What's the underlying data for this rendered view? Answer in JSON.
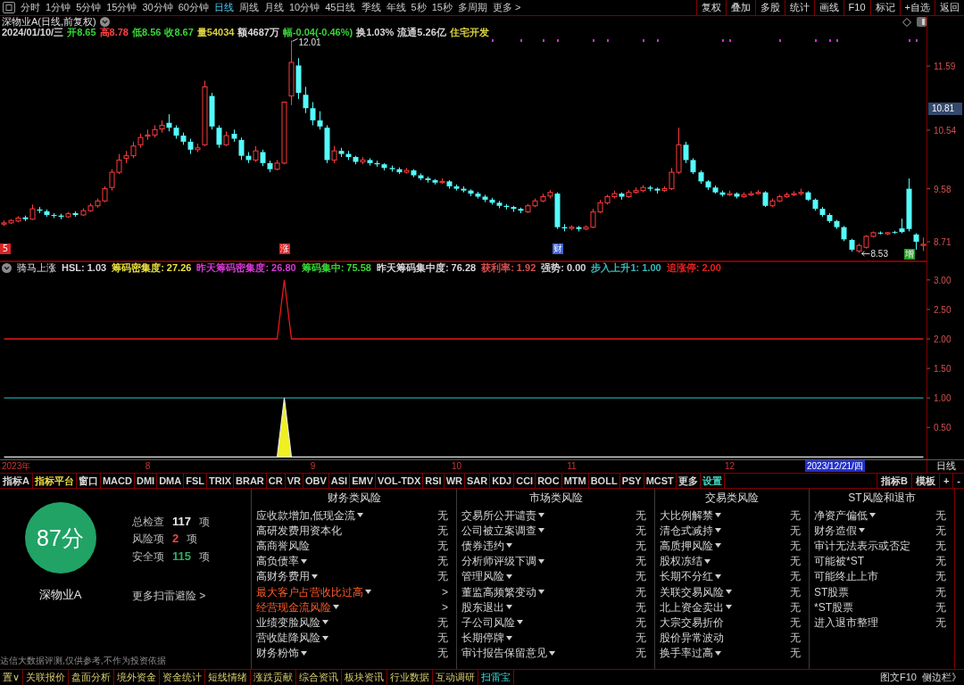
{
  "toolbar": {
    "periods": [
      {
        "label": "分时",
        "selected": false
      },
      {
        "label": "1分钟",
        "selected": false
      },
      {
        "label": "5分钟",
        "selected": false
      },
      {
        "label": "15分钟",
        "selected": false
      },
      {
        "label": "30分钟",
        "selected": false
      },
      {
        "label": "60分钟",
        "selected": false
      },
      {
        "label": "日线",
        "selected": true
      },
      {
        "label": "周线",
        "selected": false
      },
      {
        "label": "月线",
        "selected": false
      },
      {
        "label": "10分钟",
        "selected": false
      },
      {
        "label": "45日线",
        "selected": false
      },
      {
        "label": "季线",
        "selected": false
      },
      {
        "label": "年线",
        "selected": false
      },
      {
        "label": "5秒",
        "selected": false
      },
      {
        "label": "15秒",
        "selected": false
      },
      {
        "label": "多周期",
        "selected": false
      },
      {
        "label": "更多 >",
        "selected": false
      }
    ],
    "buttons": [
      "复权",
      "叠加",
      "多股",
      "统计",
      "画线",
      "F10",
      "标记",
      "+自选",
      "返回"
    ]
  },
  "price_pane": {
    "title": "深物业A(日线,前复权)",
    "quote": [
      {
        "text": "2024/01/10/三",
        "color": "#d8d8d8"
      },
      {
        "text": "开8.65",
        "color": "#39d339"
      },
      {
        "text": "高8.78",
        "color": "#ff4040"
      },
      {
        "text": "低8.56",
        "color": "#39d339"
      },
      {
        "text": "收8.67",
        "color": "#39d339"
      },
      {
        "text": "量54034",
        "color": "#d8d040"
      },
      {
        "text": "额4687万",
        "color": "#d8d8d8"
      },
      {
        "text": "幅-0.04(-0.46%)",
        "color": "#39d339"
      },
      {
        "text": "换1.03%",
        "color": "#d8d8d8"
      },
      {
        "text": "流通5.26亿",
        "color": "#d8d8d8"
      },
      {
        "text": "住宅开发",
        "color": "#d8d040"
      }
    ],
    "signal_markers": [
      {
        "label": "5",
        "color": "#d82424"
      },
      {
        "label": "涨",
        "color": "#d82424"
      },
      {
        "label": "财",
        "color": "#3a62d8"
      },
      {
        "label": "增",
        "color": "#26a026"
      }
    ],
    "cursor_price": "10.81",
    "chart_data": [
      {
        "type": "candlestick",
        "ylim": [
          8.39,
          12.41
        ],
        "yticks": [
          8.71,
          9.58,
          10.54,
          11.59
        ],
        "tick_labels": "y",
        "categories": [
          null,
          null,
          null,
          null,
          null,
          null,
          null,
          null,
          null,
          null,
          null,
          null,
          null,
          null,
          null,
          null,
          null,
          null,
          null,
          null,
          null,
          null,
          null,
          null,
          null,
          null,
          null,
          null,
          null,
          null,
          null,
          null,
          null,
          null,
          null,
          null,
          null,
          null,
          null,
          null,
          null,
          null,
          null,
          null,
          null,
          null,
          null,
          null,
          null,
          null,
          null,
          null,
          null,
          null,
          null,
          null,
          null,
          null,
          null,
          null,
          null,
          null,
          null,
          null,
          null,
          null,
          null,
          null,
          null,
          null,
          null,
          null,
          null,
          null,
          null,
          null,
          null,
          null,
          null,
          null,
          null,
          null,
          null,
          null,
          null,
          null,
          null,
          null,
          null,
          null,
          null,
          null,
          null,
          null,
          null,
          null,
          null,
          null,
          null,
          null,
          null,
          null,
          null,
          null,
          null,
          null,
          null,
          null,
          null,
          null,
          null,
          null,
          null,
          null,
          null,
          null,
          null,
          null,
          null,
          null,
          null,
          null,
          null,
          null,
          null,
          null,
          null,
          null,
          null
        ],
        "ohlc": [
          [
            9.0,
            9.06,
            8.97,
            9.02
          ],
          [
            9.02,
            9.08,
            9.0,
            9.06
          ],
          [
            9.05,
            9.13,
            9.03,
            9.1
          ],
          [
            9.11,
            9.14,
            9.05,
            9.08
          ],
          [
            9.08,
            9.32,
            9.07,
            9.25
          ],
          [
            9.24,
            9.28,
            9.18,
            9.22
          ],
          [
            9.21,
            9.24,
            9.12,
            9.15
          ],
          [
            9.15,
            9.18,
            9.1,
            9.14
          ],
          [
            9.14,
            9.17,
            9.08,
            9.12
          ],
          [
            9.12,
            9.2,
            9.1,
            9.17
          ],
          [
            9.18,
            9.21,
            9.12,
            9.15
          ],
          [
            9.15,
            9.26,
            9.14,
            9.22
          ],
          [
            9.22,
            9.34,
            9.2,
            9.3
          ],
          [
            9.3,
            9.42,
            9.27,
            9.38
          ],
          [
            9.38,
            9.62,
            9.36,
            9.58
          ],
          [
            9.6,
            9.9,
            9.55,
            9.85
          ],
          [
            9.85,
            10.15,
            9.82,
            10.05
          ],
          [
            10.08,
            10.2,
            10.0,
            10.12
          ],
          [
            10.12,
            10.35,
            10.08,
            10.28
          ],
          [
            10.3,
            10.48,
            10.25,
            10.42
          ],
          [
            10.44,
            10.55,
            10.38,
            10.46
          ],
          [
            10.46,
            10.62,
            10.42,
            10.55
          ],
          [
            10.56,
            10.7,
            10.5,
            10.62
          ],
          [
            10.66,
            10.8,
            10.52,
            10.58
          ],
          [
            10.58,
            10.62,
            10.4,
            10.45
          ],
          [
            10.45,
            10.5,
            10.3,
            10.35
          ],
          [
            10.35,
            10.4,
            10.15,
            10.22
          ],
          [
            10.22,
            10.32,
            10.18,
            10.25
          ],
          [
            10.3,
            11.35,
            10.28,
            11.25
          ],
          [
            11.1,
            11.15,
            10.55,
            10.6
          ],
          [
            10.58,
            10.62,
            10.25,
            10.3
          ],
          [
            10.3,
            10.52,
            10.28,
            10.45
          ],
          [
            10.48,
            10.55,
            10.35,
            10.4
          ],
          [
            10.38,
            10.42,
            10.05,
            10.12
          ],
          [
            10.12,
            10.18,
            10.0,
            10.05
          ],
          [
            10.05,
            10.28,
            10.02,
            10.2
          ],
          [
            10.18,
            10.22,
            9.95,
            10.0
          ],
          [
            10.0,
            10.04,
            9.85,
            9.9
          ],
          [
            9.9,
            10.05,
            9.88,
            10.0
          ],
          [
            10.0,
            11.0,
            9.98,
            11.0
          ],
          [
            11.1,
            12.01,
            10.95,
            11.65
          ],
          [
            11.6,
            11.72,
            11.05,
            11.15
          ],
          [
            11.12,
            11.25,
            10.82,
            10.9
          ],
          [
            10.9,
            11.0,
            10.62,
            10.7
          ],
          [
            10.7,
            10.85,
            10.55,
            10.6
          ],
          [
            10.58,
            10.62,
            10.0,
            10.05
          ],
          [
            10.05,
            10.28,
            10.0,
            10.2
          ],
          [
            10.2,
            10.25,
            10.1,
            10.15
          ],
          [
            10.15,
            10.2,
            10.05,
            10.1
          ],
          [
            10.1,
            10.12,
            9.98,
            10.02
          ],
          [
            10.02,
            10.1,
            9.98,
            10.05
          ],
          [
            10.05,
            10.08,
            9.96,
            10.0
          ],
          [
            10.0,
            10.04,
            9.94,
            9.98
          ],
          [
            9.98,
            10.0,
            9.88,
            9.92
          ],
          [
            9.92,
            9.96,
            9.86,
            9.9
          ],
          [
            9.9,
            9.93,
            9.82,
            9.85
          ],
          [
            9.85,
            9.92,
            9.83,
            9.88
          ],
          [
            9.88,
            9.9,
            9.77,
            9.8
          ],
          [
            9.8,
            9.83,
            9.72,
            9.75
          ],
          [
            9.75,
            9.78,
            9.68,
            9.72
          ],
          [
            9.72,
            9.74,
            9.65,
            9.68
          ],
          [
            9.68,
            9.75,
            9.66,
            9.7
          ],
          [
            9.7,
            9.72,
            9.58,
            9.62
          ],
          [
            9.62,
            9.65,
            9.55,
            9.58
          ],
          [
            9.58,
            9.62,
            9.52,
            9.55
          ],
          [
            9.55,
            9.57,
            9.46,
            9.5
          ],
          [
            9.5,
            9.53,
            9.42,
            9.45
          ],
          [
            9.45,
            9.48,
            9.36,
            9.4
          ],
          [
            9.4,
            9.43,
            9.32,
            9.35
          ],
          [
            9.35,
            9.38,
            9.26,
            9.3
          ],
          [
            9.3,
            9.33,
            9.24,
            9.28
          ],
          [
            9.28,
            9.3,
            9.2,
            9.25
          ],
          [
            9.25,
            9.27,
            9.18,
            9.22
          ],
          [
            9.2,
            9.33,
            9.18,
            9.3
          ],
          [
            9.3,
            9.42,
            9.28,
            9.38
          ],
          [
            9.38,
            9.5,
            9.36,
            9.45
          ],
          [
            9.46,
            9.56,
            9.42,
            9.52
          ],
          [
            9.5,
            9.52,
            8.92,
            8.95
          ],
          [
            8.95,
            9.0,
            8.88,
            8.93
          ],
          [
            8.93,
            8.98,
            8.9,
            8.95
          ],
          [
            8.95,
            8.97,
            8.88,
            8.92
          ],
          [
            8.92,
            8.98,
            8.9,
            8.95
          ],
          [
            8.95,
            9.25,
            8.93,
            9.2
          ],
          [
            9.2,
            9.4,
            9.18,
            9.35
          ],
          [
            9.35,
            9.48,
            9.32,
            9.45
          ],
          [
            9.45,
            9.55,
            9.42,
            9.5
          ],
          [
            9.5,
            9.52,
            9.4,
            9.45
          ],
          [
            9.45,
            9.56,
            9.43,
            9.52
          ],
          [
            9.52,
            9.6,
            9.5,
            9.55
          ],
          [
            9.55,
            9.64,
            9.52,
            9.6
          ],
          [
            9.6,
            9.63,
            9.54,
            9.58
          ],
          [
            9.58,
            9.6,
            9.5,
            9.55
          ],
          [
            9.55,
            9.62,
            9.53,
            9.58
          ],
          [
            9.58,
            9.92,
            9.56,
            9.85
          ],
          [
            9.85,
            10.58,
            9.82,
            10.3
          ],
          [
            10.3,
            10.35,
            10.0,
            10.05
          ],
          [
            10.05,
            10.08,
            9.82,
            9.85
          ],
          [
            9.85,
            9.88,
            9.66,
            9.7
          ],
          [
            9.7,
            9.72,
            9.56,
            9.6
          ],
          [
            9.6,
            9.63,
            9.5,
            9.52
          ],
          [
            9.52,
            9.55,
            9.45,
            9.48
          ],
          [
            9.48,
            9.55,
            9.46,
            9.5
          ],
          [
            9.5,
            9.52,
            9.42,
            9.45
          ],
          [
            9.45,
            9.52,
            9.43,
            9.48
          ],
          [
            9.48,
            9.54,
            9.46,
            9.5
          ],
          [
            9.5,
            9.56,
            9.48,
            9.52
          ],
          [
            9.52,
            9.54,
            9.28,
            9.3
          ],
          [
            9.3,
            9.42,
            9.28,
            9.38
          ],
          [
            9.38,
            9.48,
            9.36,
            9.45
          ],
          [
            9.45,
            9.52,
            9.43,
            9.48
          ],
          [
            9.48,
            9.54,
            9.46,
            9.5
          ],
          [
            9.5,
            9.58,
            9.47,
            9.52
          ],
          [
            9.52,
            9.54,
            9.38,
            9.4
          ],
          [
            9.4,
            9.42,
            9.22,
            9.25
          ],
          [
            9.25,
            9.28,
            9.12,
            9.15
          ],
          [
            9.15,
            9.18,
            9.02,
            9.05
          ],
          [
            9.05,
            9.07,
            8.92,
            8.95
          ],
          [
            8.95,
            8.97,
            8.72,
            8.75
          ],
          [
            8.74,
            8.76,
            8.55,
            8.58
          ],
          [
            8.56,
            8.68,
            8.53,
            8.65
          ],
          [
            8.62,
            8.82,
            8.6,
            8.8
          ],
          [
            8.8,
            8.88,
            8.78,
            8.86
          ],
          [
            8.86,
            8.88,
            8.83,
            8.85
          ],
          [
            8.84,
            8.87,
            8.82,
            8.86
          ],
          [
            8.87,
            8.89,
            8.84,
            8.86
          ],
          [
            8.93,
            9.09,
            8.85,
            8.87
          ],
          [
            9.58,
            9.75,
            8.88,
            8.92
          ],
          [
            8.83,
            8.85,
            8.58,
            8.71
          ],
          [
            8.65,
            8.78,
            8.56,
            8.67
          ]
        ],
        "annotations": [
          "12.01",
          "8.53"
        ]
      }
    ]
  },
  "indicator_pane": {
    "indicator_name": "骑马上涨",
    "readouts": [
      {
        "text": "HSL: 1.03",
        "color": "#d8d8d8"
      },
      {
        "text": "筹码密集度: 27.26",
        "color": "#e8e040"
      },
      {
        "text": "昨天筹码密集度: 26.80",
        "color": "#d838d8"
      },
      {
        "text": "筹码集中: 75.58",
        "color": "#38d838"
      },
      {
        "text": "昨天筹码集中度: 76.28",
        "color": "#d8d8d8"
      },
      {
        "text": "获利率: 1.92",
        "color": "#d85050"
      },
      {
        "text": "强势: 0.00",
        "color": "#d8d8d8"
      },
      {
        "text": "步入上升1: 1.00",
        "color": "#38b8b8"
      },
      {
        "text": "追涨停: 2.00",
        "color": "#e82020"
      }
    ],
    "chart_data": [
      {
        "type": "line",
        "ylim": [
          -0.04,
          3.315
        ],
        "yticks": [
          {
            "value": 0.5,
            "label": "0.50"
          },
          {
            "value": 1,
            "label": "1.00"
          },
          {
            "value": 1.5,
            "label": "1.50"
          },
          {
            "value": 2,
            "label": "2.00"
          },
          {
            "value": 2.5,
            "label": "2.50"
          },
          {
            "value": 3,
            "label": "3.00"
          }
        ],
        "categories": [
          null,
          null,
          null,
          null,
          null,
          null,
          null,
          null,
          null,
          null,
          null,
          null,
          null,
          null,
          null,
          null,
          null,
          null,
          null,
          null,
          "8",
          null,
          null,
          null,
          null,
          null,
          null,
          null,
          null,
          null,
          null,
          null,
          null,
          null,
          null,
          null,
          null,
          null,
          null,
          null,
          null,
          null,
          null,
          "9",
          null,
          null,
          null,
          null,
          null,
          null,
          null,
          null,
          null,
          null,
          null,
          null,
          null,
          null,
          null,
          null,
          null,
          null,
          null,
          "10",
          null,
          null,
          null,
          null,
          null,
          null,
          null,
          null,
          null,
          null,
          null,
          null,
          null,
          null,
          null,
          "11",
          null,
          null,
          null,
          null,
          null,
          null,
          null,
          null,
          null,
          null,
          null,
          null,
          null,
          null,
          null,
          null,
          null,
          null,
          null,
          null,
          null,
          "12",
          null,
          null,
          null,
          null,
          null,
          null,
          null,
          null,
          null,
          null,
          null,
          null,
          null,
          null,
          null,
          null,
          null,
          null,
          null,
          null,
          null,
          null,
          null,
          null,
          null,
          null,
          null
        ],
        "series": [
          {
            "type": "line",
            "color": "#e81818",
            "values": [
              2,
              2,
              2,
              2,
              2,
              2,
              2,
              2,
              2,
              2,
              2,
              2,
              2,
              2,
              2,
              2,
              2,
              2,
              2,
              2,
              2,
              2,
              2,
              2,
              2,
              2,
              2,
              2,
              2,
              2,
              2,
              2,
              2,
              2,
              2,
              2,
              2,
              2,
              2,
              3,
              2,
              2,
              2,
              2,
              2,
              2,
              2,
              2,
              2,
              2,
              2,
              2,
              2,
              2,
              2,
              2,
              2,
              2,
              2,
              2,
              2,
              2,
              2,
              2,
              2,
              2,
              2,
              2,
              2,
              2,
              2,
              2,
              2,
              2,
              2,
              2,
              2,
              2,
              2,
              2,
              2,
              2,
              2,
              2,
              2,
              2,
              2,
              2,
              2,
              2,
              2,
              2,
              2,
              2,
              2,
              2,
              2,
              2,
              2,
              2,
              2,
              2,
              2,
              2,
              2,
              2,
              2,
              2,
              2,
              2,
              2,
              2,
              2,
              2,
              2,
              2,
              2,
              2,
              2,
              2,
              2,
              2,
              2,
              2,
              2,
              2,
              2,
              2,
              2
            ]
          },
          {
            "type": "line",
            "color": "#1fa5a5",
            "values": [
              1,
              1,
              1,
              1,
              1,
              1,
              1,
              1,
              1,
              1,
              1,
              1,
              1,
              1,
              1,
              1,
              1,
              1,
              1,
              1,
              1,
              1,
              1,
              1,
              1,
              1,
              1,
              1,
              1,
              1,
              1,
              1,
              1,
              1,
              1,
              1,
              1,
              1,
              1,
              1,
              1,
              1,
              1,
              1,
              1,
              1,
              1,
              1,
              1,
              1,
              1,
              1,
              1,
              1,
              1,
              1,
              1,
              1,
              1,
              1,
              1,
              1,
              1,
              1,
              1,
              1,
              1,
              1,
              1,
              1,
              1,
              1,
              1,
              1,
              1,
              1,
              1,
              1,
              1,
              1,
              1,
              1,
              1,
              1,
              1,
              1,
              1,
              1,
              1,
              1,
              1,
              1,
              1,
              1,
              1,
              1,
              1,
              1,
              1,
              1,
              1,
              1,
              1,
              1,
              1,
              1,
              1,
              1,
              1,
              1,
              1,
              1,
              1,
              1,
              1,
              1,
              1,
              1,
              1,
              1,
              1,
              1,
              1,
              1,
              1,
              1,
              1,
              1,
              1
            ]
          },
          {
            "type": "area",
            "color": "#f0f020",
            "values": [
              0,
              0,
              0,
              0,
              0,
              0,
              0,
              0,
              0,
              0,
              0,
              0,
              0,
              0,
              0,
              0,
              0,
              0,
              0,
              0,
              0,
              0,
              0,
              0,
              0,
              0,
              0,
              0,
              0,
              0,
              0,
              0,
              0,
              0,
              0,
              0,
              0,
              0,
              0,
              1,
              0,
              0,
              0,
              0,
              0,
              0,
              0,
              0,
              0,
              0,
              0,
              0,
              0,
              0,
              0,
              0,
              0,
              0,
              0,
              0,
              0,
              0,
              0,
              0,
              0,
              0,
              0,
              0,
              0,
              0,
              0,
              0,
              0,
              0,
              0,
              0,
              0,
              0,
              0,
              0,
              0,
              0,
              0,
              0,
              0,
              0,
              0,
              0,
              0,
              0,
              0,
              0,
              0,
              0,
              0,
              0,
              0,
              0,
              0,
              0,
              0,
              0,
              0,
              0,
              0,
              0,
              0,
              0,
              0,
              0,
              0,
              0,
              0,
              0,
              0,
              0,
              0,
              0,
              0,
              0,
              0,
              0,
              0,
              0,
              0,
              0,
              0,
              0,
              0
            ]
          }
        ]
      }
    ],
    "year_label": "2023年",
    "cursor_date": "2023/12/21/四",
    "period_label": "日线"
  },
  "indicator_tabs": {
    "left_label": "指标A",
    "items": [
      {
        "label": "指标平台",
        "color": "#e8d840"
      },
      {
        "label": "窗口",
        "color": "#d8d8d8"
      },
      {
        "label": "MACD",
        "color": "#d8d8d8"
      },
      {
        "label": "DMI",
        "color": "#d8d8d8"
      },
      {
        "label": "DMA",
        "color": "#d8d8d8"
      },
      {
        "label": "FSL",
        "color": "#d8d8d8"
      },
      {
        "label": "TRIX",
        "color": "#d8d8d8"
      },
      {
        "label": "BRAR",
        "color": "#d8d8d8"
      },
      {
        "label": "CR",
        "color": "#d8d8d8"
      },
      {
        "label": "VR",
        "color": "#d8d8d8"
      },
      {
        "label": "OBV",
        "color": "#d8d8d8"
      },
      {
        "label": "ASI",
        "color": "#d8d8d8"
      },
      {
        "label": "EMV",
        "color": "#d8d8d8"
      },
      {
        "label": "VOL-TDX",
        "color": "#d8d8d8"
      },
      {
        "label": "RSI",
        "color": "#d8d8d8"
      },
      {
        "label": "WR",
        "color": "#d8d8d8"
      },
      {
        "label": "SAR",
        "color": "#d8d8d8"
      },
      {
        "label": "KDJ",
        "color": "#d8d8d8"
      },
      {
        "label": "CCI",
        "color": "#d8d8d8"
      },
      {
        "label": "ROC",
        "color": "#d8d8d8"
      },
      {
        "label": "MTM",
        "color": "#d8d8d8"
      },
      {
        "label": "BOLL",
        "color": "#d8d8d8"
      },
      {
        "label": "PSY",
        "color": "#d8d8d8"
      },
      {
        "label": "MCST",
        "color": "#d8d8d8"
      },
      {
        "label": "更多",
        "color": "#d8d8d8"
      },
      {
        "label": "设置",
        "color": "#40d8c0"
      }
    ],
    "right_items": [
      "指标B",
      "模板",
      "+",
      "-"
    ]
  },
  "scan_panel": {
    "score": "87分",
    "stock": "深物业A",
    "stats": [
      {
        "label": "总检查",
        "value": "117",
        "unit": "项",
        "color": "#e8e8e8"
      },
      {
        "label": "风险项",
        "value": "2",
        "unit": "项",
        "color": "#e84848"
      },
      {
        "label": "安全项",
        "value": "115",
        "unit": "项",
        "color": "#2eb060"
      }
    ],
    "more_link": "更多扫雷避险 >",
    "disclaimer": "达信大数据评测,仅供参考,不作为投资依据",
    "columns": [
      {
        "title": "财务类风险",
        "items": [
          {
            "text": "应收款增加,低现金流",
            "expandable": true,
            "risk": false,
            "status": "无"
          },
          {
            "text": "高研发费用资本化",
            "expandable": false,
            "risk": false,
            "status": "无"
          },
          {
            "text": "高商誉风险",
            "expandable": false,
            "risk": false,
            "status": "无"
          },
          {
            "text": "高负债率",
            "expandable": true,
            "risk": false,
            "status": "无"
          },
          {
            "text": "高财务费用",
            "expandable": true,
            "risk": false,
            "status": "无"
          },
          {
            "text": "最大客户占营收比过高",
            "expandable": true,
            "risk": true,
            "status": ">"
          },
          {
            "text": "经营现金流风险",
            "expandable": true,
            "risk": true,
            "status": ">"
          },
          {
            "text": "业绩变脸风险",
            "expandable": true,
            "risk": false,
            "status": "无"
          },
          {
            "text": "营收陡降风险",
            "expandable": true,
            "risk": false,
            "status": "无"
          },
          {
            "text": "财务粉饰",
            "expandable": true,
            "risk": false,
            "status": "无"
          }
        ]
      },
      {
        "title": "市场类风险",
        "items": [
          {
            "text": "交易所公开谴责",
            "expandable": true,
            "risk": false,
            "status": "无"
          },
          {
            "text": "公司被立案调查",
            "expandable": true,
            "risk": false,
            "status": "无"
          },
          {
            "text": "债券违约",
            "expandable": true,
            "risk": false,
            "status": "无"
          },
          {
            "text": "分析师评级下调",
            "expandable": true,
            "risk": false,
            "status": "无"
          },
          {
            "text": "管理风险",
            "expandable": true,
            "risk": false,
            "status": "无"
          },
          {
            "text": "董监高频繁变动",
            "expandable": true,
            "risk": false,
            "status": "无"
          },
          {
            "text": "股东退出",
            "expandable": true,
            "risk": false,
            "status": "无"
          },
          {
            "text": "子公司风险",
            "expandable": true,
            "risk": false,
            "status": "无"
          },
          {
            "text": "长期停牌",
            "expandable": true,
            "risk": false,
            "status": "无"
          },
          {
            "text": "审计报告保留意见",
            "expandable": true,
            "risk": false,
            "status": "无"
          }
        ]
      },
      {
        "title": "交易类风险",
        "items": [
          {
            "text": "大比例解禁",
            "expandable": true,
            "risk": false,
            "status": "无"
          },
          {
            "text": "清仓式减持",
            "expandable": true,
            "risk": false,
            "status": "无"
          },
          {
            "text": "高质押风险",
            "expandable": true,
            "risk": false,
            "status": "无"
          },
          {
            "text": "股权冻结",
            "expandable": true,
            "risk": false,
            "status": "无"
          },
          {
            "text": "长期不分红",
            "expandable": true,
            "risk": false,
            "status": "无"
          },
          {
            "text": "关联交易风险",
            "expandable": true,
            "risk": false,
            "status": "无"
          },
          {
            "text": "北上资金卖出",
            "expandable": true,
            "risk": false,
            "status": "无"
          },
          {
            "text": "大宗交易折价",
            "expandable": false,
            "risk": false,
            "status": "无"
          },
          {
            "text": "股价异常波动",
            "expandable": false,
            "risk": false,
            "status": "无"
          },
          {
            "text": "换手率过高",
            "expandable": true,
            "risk": false,
            "status": "无"
          }
        ]
      },
      {
        "title": "ST风险和退市",
        "items": [
          {
            "text": "净资产偏低",
            "expandable": true,
            "risk": false,
            "status": "无"
          },
          {
            "text": "财务造假",
            "expandable": true,
            "risk": false,
            "status": "无"
          },
          {
            "text": "审计无法表示或否定",
            "expandable": false,
            "risk": false,
            "status": "无"
          },
          {
            "text": "可能被*ST",
            "expandable": false,
            "risk": false,
            "status": "无"
          },
          {
            "text": "可能终止上市",
            "expandable": false,
            "risk": false,
            "status": "无"
          },
          {
            "text": "ST股票",
            "expandable": false,
            "risk": false,
            "status": "无"
          },
          {
            "text": "*ST股票",
            "expandable": false,
            "risk": false,
            "status": "无"
          },
          {
            "text": "进入退市整理",
            "expandable": false,
            "risk": false,
            "status": "无"
          }
        ]
      }
    ]
  },
  "bottom_tabs": {
    "items": [
      {
        "label": "置∨",
        "selected": false
      },
      {
        "label": "关联报价",
        "selected": false
      },
      {
        "label": "盘面分析",
        "selected": false
      },
      {
        "label": "境外资金",
        "selected": false
      },
      {
        "label": "资金统计",
        "selected": false
      },
      {
        "label": "短线情绪",
        "selected": false
      },
      {
        "label": "涨跌贡献",
        "selected": false
      },
      {
        "label": "综合资讯",
        "selected": false
      },
      {
        "label": "板块资讯",
        "selected": false
      },
      {
        "label": "行业数据",
        "selected": false
      },
      {
        "label": "互动调研",
        "selected": false
      },
      {
        "label": "扫雷宝",
        "selected": true
      }
    ],
    "right_items": [
      "图文F10",
      "侧边栏》"
    ]
  }
}
